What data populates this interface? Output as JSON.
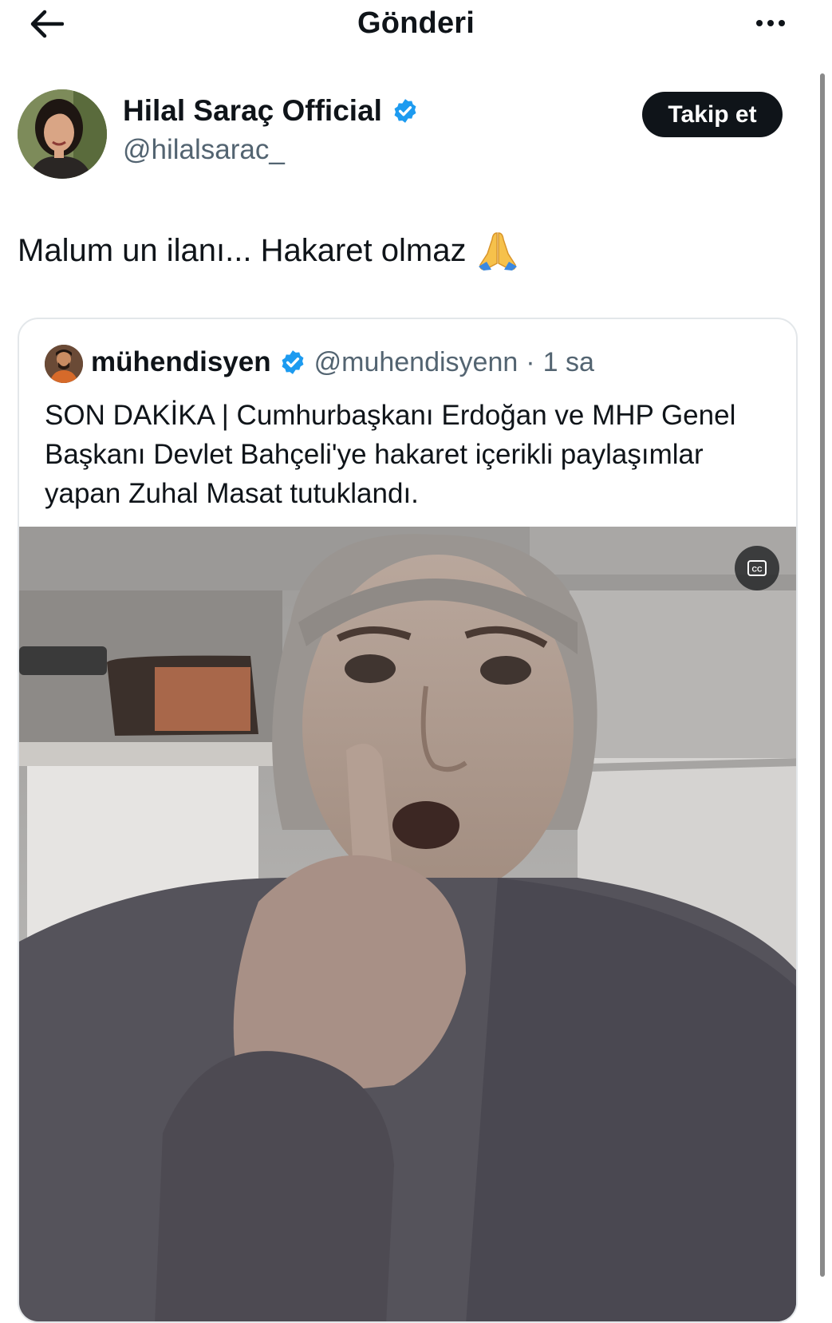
{
  "header": {
    "title": "Gönderi",
    "back_icon": "arrow-left-icon",
    "more_icon": "more-horizontal-icon"
  },
  "tweet": {
    "author": {
      "display_name": "Hilal Saraç Official",
      "handle": "@hilalsarac_",
      "verified": true
    },
    "follow_label": "Takip et",
    "text": "Malum un ilanı... Hakaret olmaz",
    "emoji_icon": "folded-hands-icon"
  },
  "quoted_tweet": {
    "author": {
      "display_name": "mühendisyen",
      "handle": "@muhendisyenn",
      "verified": true
    },
    "separator": "·",
    "time": "1 sa",
    "text": "SON DAKİKA | Cumhurbaşkanı Erdoğan ve MHP Genel Başkanı Devlet Bahçeli'ye hakaret içerikli paylaşımlar yapan Zuhal Masat tutuklandı.",
    "media": {
      "type": "video",
      "cc_icon": "closed-captions-icon"
    }
  },
  "colors": {
    "verified_blue": "#1d9bf0",
    "follow_bg": "#0f1419",
    "secondary_text": "#536471",
    "card_border": "#e3e7ea"
  }
}
